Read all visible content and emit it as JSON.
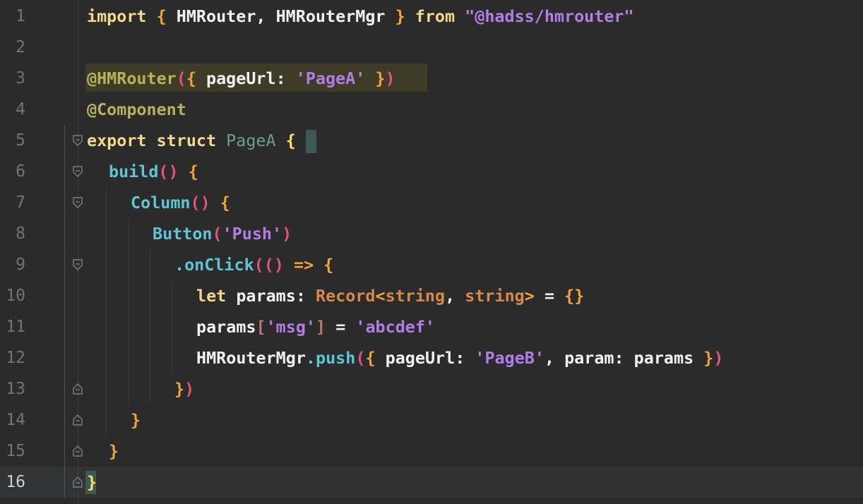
{
  "line_numbers": [
    "1",
    "2",
    "3",
    "4",
    "5",
    "6",
    "7",
    "8",
    "9",
    "10",
    "11",
    "12",
    "13",
    "14",
    "15",
    "16"
  ],
  "lines": {
    "l1": {
      "import": "import",
      "lb": " { ",
      "names": "HMRouter, HMRouterMgr",
      "rb": " } ",
      "from": "from",
      "sp": " ",
      "str": "\"@hadss/hmrouter\""
    },
    "l3": {
      "dec": "@HMRouter",
      "p1": "(",
      "b1": "{",
      "key": " pageUrl: ",
      "str": "'PageA'",
      "b2": " }",
      "p2": ")"
    },
    "l4": {
      "dec": "@Component"
    },
    "l5": {
      "kw": "export struct",
      "sp": " ",
      "name": "PageA",
      "sp2": " ",
      "brace": "{"
    },
    "l6": {
      "fn": "build",
      "paren": "()",
      "sp": " ",
      "brace": "{"
    },
    "l7": {
      "fn": "Column",
      "paren": "()",
      "sp": " ",
      "brace": "{"
    },
    "l8": {
      "fn": "Button",
      "p1": "(",
      "str": "'Push'",
      "p2": ")"
    },
    "l9": {
      "dot": ".",
      "fn": "onClick",
      "p1": "(",
      "p2": "()",
      "arrow": " => ",
      "brace": "{"
    },
    "l10": {
      "kw": "let",
      "var": " params: ",
      "type": "Record",
      "lt": "<",
      "t1": "string",
      "comma": ", ",
      "t2": "string",
      "gt": ">",
      "eq": " = ",
      "obj": "{}"
    },
    "l11": {
      "var": "params",
      "lb": "[",
      "str": "'msg'",
      "rb": "]",
      "eq": " = ",
      "val": "'abcdef'"
    },
    "l12": {
      "obj": "HMRouterMgr",
      "dot": ".",
      "fn": "push",
      "p1": "(",
      "b1": "{",
      "k1": " pageUrl: ",
      "s1": "'PageB'",
      "c": ", param: params ",
      "b2": "}",
      "p2": ")"
    },
    "l13": {
      "brace": "}",
      "paren": ")"
    },
    "l14": {
      "brace": "}"
    },
    "l15": {
      "brace": "}"
    },
    "l16": {
      "brace": "}"
    }
  },
  "colors": {
    "background": "#2b2b2b",
    "keyword": "#f0d98a",
    "string": "#b27de6",
    "decorator": "#b6b25a",
    "function": "#5ec4d6",
    "brace": "#f2a33a"
  },
  "icons": [
    "fold-open-icon",
    "fold-close-icon"
  ]
}
